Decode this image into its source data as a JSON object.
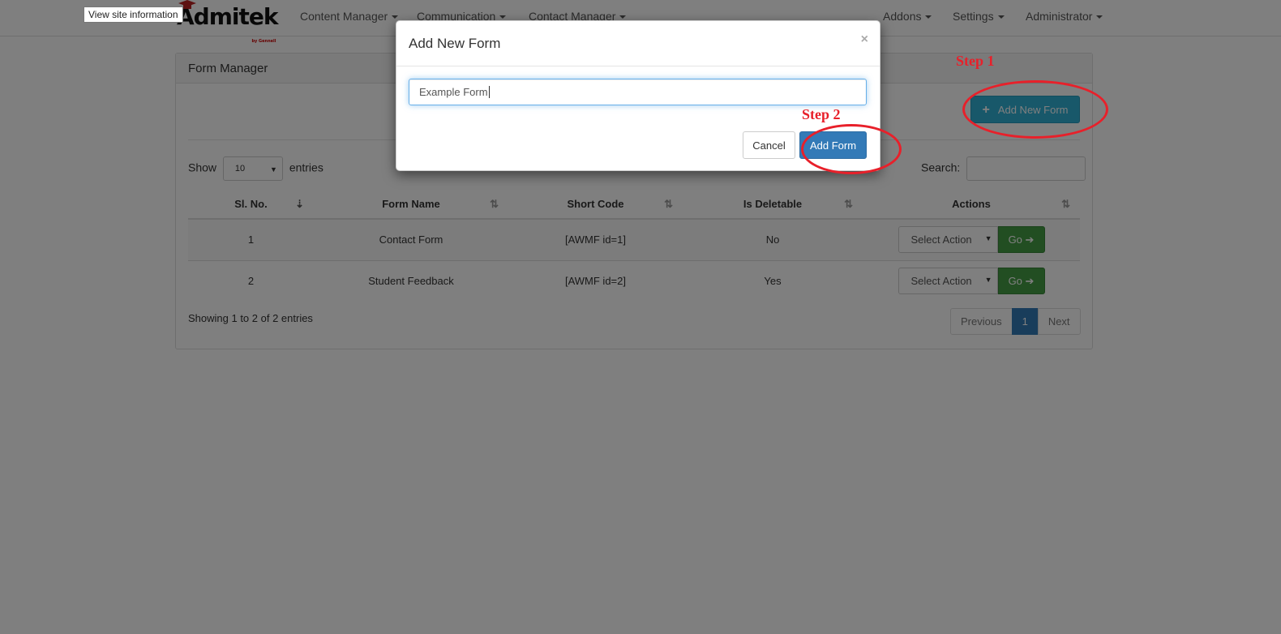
{
  "tooltip": "View site information",
  "brand": {
    "name": "Admitek",
    "sub": "by Gennell"
  },
  "nav": {
    "content_manager": "Content Manager",
    "communication": "Communication",
    "contact_manager": "Contact Manager",
    "addons": "Addons",
    "settings": "Settings",
    "administrator": "Administrator"
  },
  "panel": {
    "title": "Form Manager",
    "add_new_form": "Add New Form",
    "show_label": "Show",
    "entries_label": "entries",
    "length_value": "10",
    "search_label": "Search:",
    "columns": [
      "Sl. No.",
      "Form Name",
      "Short Code",
      "Is Deletable",
      "Actions"
    ],
    "rows": [
      {
        "sl": "1",
        "name": "Contact Form",
        "code": "[AWMF id=1]",
        "deletable": "No"
      },
      {
        "sl": "2",
        "name": "Student Feedback",
        "code": "[AWMF id=2]",
        "deletable": "Yes"
      }
    ],
    "action_placeholder": "Select Action",
    "go_label": "Go",
    "showing": "Showing 1 to 2 of 2 entries",
    "pager": {
      "previous": "Previous",
      "current": "1",
      "next": "Next"
    }
  },
  "modal": {
    "title": "Add New Form",
    "close": "×",
    "input_value": "Example Form",
    "cancel": "Cancel",
    "submit": "Add Form"
  },
  "annotations": {
    "step1": "Step 1",
    "step2": "Step 2"
  },
  "colors": {
    "accent": "#337ab7",
    "info": "#31b0d5",
    "success": "#449d44",
    "annotation": "#e8202a"
  }
}
